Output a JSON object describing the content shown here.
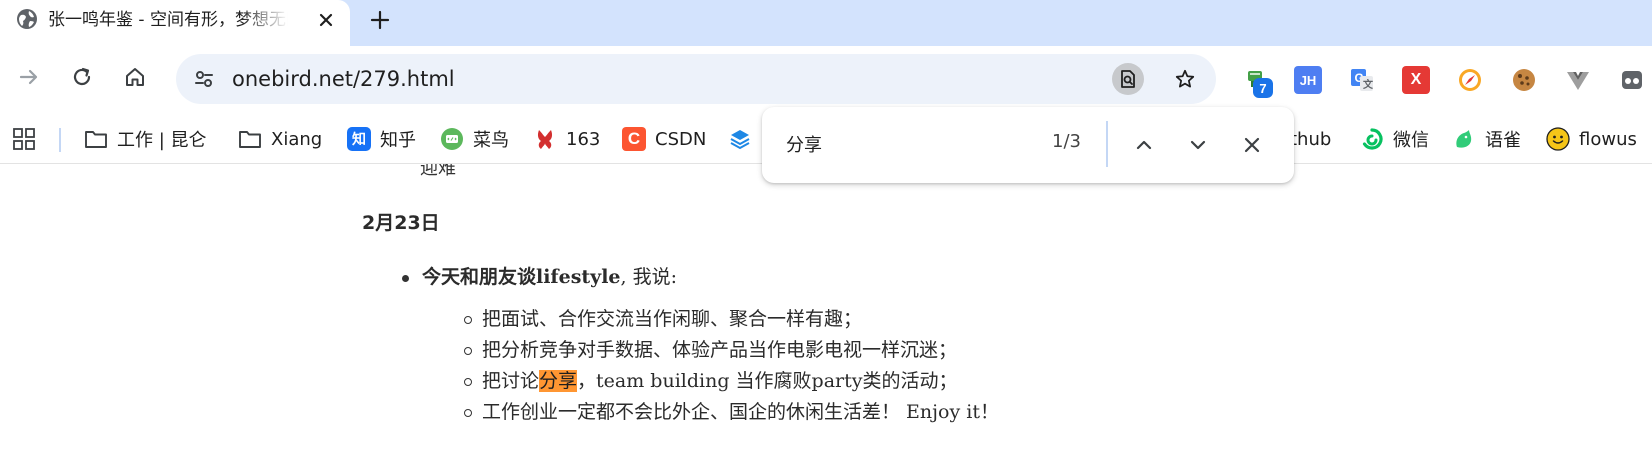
{
  "tab": {
    "title": "张一鸣年鉴 - 空间有形，梦想无限",
    "favicon": "globe-icon",
    "close": "close-icon"
  },
  "new_tab": "plus-icon",
  "toolbar": {
    "forward": "arrow-forward-icon",
    "reload": "reload-icon",
    "home": "home-icon",
    "site_info": "tune-icon",
    "url": "onebird.net/279.html",
    "find_in_page": "find-in-page-icon",
    "bookmark_star": "star-icon",
    "extensions": [
      {
        "name": "frog-extension",
        "badge": "7",
        "color": "#2e7d32"
      },
      {
        "name": "jh-extension",
        "label": "JH",
        "color": "#4e7ef2"
      },
      {
        "name": "google-translate-extension",
        "label": "G",
        "color": "#4285f4"
      },
      {
        "name": "x-extension",
        "label": "X",
        "color": "#e53935"
      },
      {
        "name": "compass-extension",
        "color": "#f9a825"
      },
      {
        "name": "cookie-extension",
        "color": "#a0522d"
      },
      {
        "name": "vue-extension",
        "color": "#9e9e9e"
      },
      {
        "name": "incognito-extension",
        "color": "#5f6368"
      }
    ]
  },
  "bookmarks": [
    {
      "label": "",
      "icon": "apps-grid-icon"
    },
    {
      "label": "工作 | 昆仑",
      "icon": "folder-icon"
    },
    {
      "label": "Xiang",
      "icon": "folder-icon"
    },
    {
      "label": "知乎",
      "icon": "zhihu-icon",
      "color": "#1772f6",
      "glyph": "知"
    },
    {
      "label": "菜鸟",
      "icon": "runoob-icon",
      "color": "#5cb85c"
    },
    {
      "label": "163",
      "icon": "163-icon",
      "color": "#d32f2f"
    },
    {
      "label": "CSDN",
      "icon": "csdn-icon",
      "color": "#fc5531",
      "glyph": "C"
    },
    {
      "label": "",
      "icon": "layers-icon",
      "color": "#1e88e5"
    },
    {
      "label": "thub",
      "icon": ""
    },
    {
      "label": "微信",
      "icon": "wechat-icon",
      "color": "#07c160"
    },
    {
      "label": "语雀",
      "icon": "yuque-icon",
      "color": "#31cc79"
    },
    {
      "label": "flowus",
      "icon": "flowus-icon",
      "color": "#f5c518"
    }
  ],
  "content": {
    "cut_line": "迎难",
    "date_heading": "2月23日",
    "bullet_bold": "今天和朋友谈lifestyle",
    "bullet_rest": ", 我说:",
    "sub_items": [
      "把面试、合作交流当作闲聊、聚合一样有趣；",
      "把分析竞争对手数据、体验产品当作电影电视一样沉迷；",
      {
        "before": "把讨论",
        "highlight": "分享",
        "after": "，team building 当作腐败party类的活动；"
      },
      "工作创业一定都不会比外企、国企的休闲生活差！ Enjoy it！"
    ]
  },
  "find_bar": {
    "query": "分享",
    "count": "1/3",
    "prev": "chevron-up-icon",
    "next": "chevron-down-icon",
    "close": "close-icon"
  }
}
